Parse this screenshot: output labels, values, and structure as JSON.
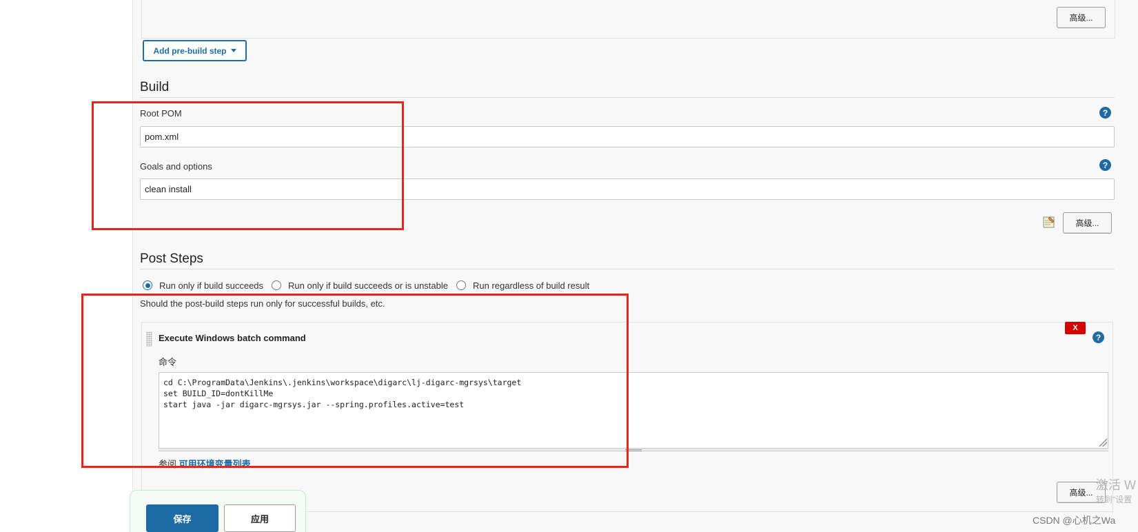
{
  "prebuild": {
    "advanced_label": "高级...",
    "add_step_label": "Add pre-build step"
  },
  "build": {
    "section_title": "Build",
    "root_pom_label": "Root POM",
    "root_pom_value": "pom.xml",
    "goals_label": "Goals and options",
    "goals_value": "clean install",
    "advanced_label": "高级..."
  },
  "post_steps": {
    "section_title": "Post Steps",
    "radio_options": [
      {
        "label": "Run only if build succeeds",
        "checked": true
      },
      {
        "label": "Run only if build succeeds or is unstable",
        "checked": false
      },
      {
        "label": "Run regardless of build result",
        "checked": false
      }
    ],
    "description": "Should the post-build steps run only for successful builds, etc.",
    "step": {
      "title": "Execute Windows batch command",
      "delete_label": "X",
      "command_label": "命令",
      "command_lines": [
        "cd C:\\ProgramData\\Jenkins\\.jenkins\\workspace\\digarc\\lj-digarc-mgrsys\\target",
        "set BUILD_ID=dontKillMe",
        "start java -jar digarc-mgrsys.jar --spring.profiles.active=test"
      ],
      "ref_prefix": "参阅",
      "ref_link": "可用环境变量列表"
    },
    "advanced_label": "高级..."
  },
  "actions": {
    "save_label": "保存",
    "apply_label": "应用"
  },
  "help_icon_glyph": "?",
  "watermarks": {
    "activate": "激活 W",
    "activate_sub": "转到\"设置",
    "csdn": "CSDN @心机之Wa"
  },
  "colors": {
    "accent": "#1d6ba5",
    "annotation_red": "#e8241c",
    "delete_red": "#d40000"
  }
}
